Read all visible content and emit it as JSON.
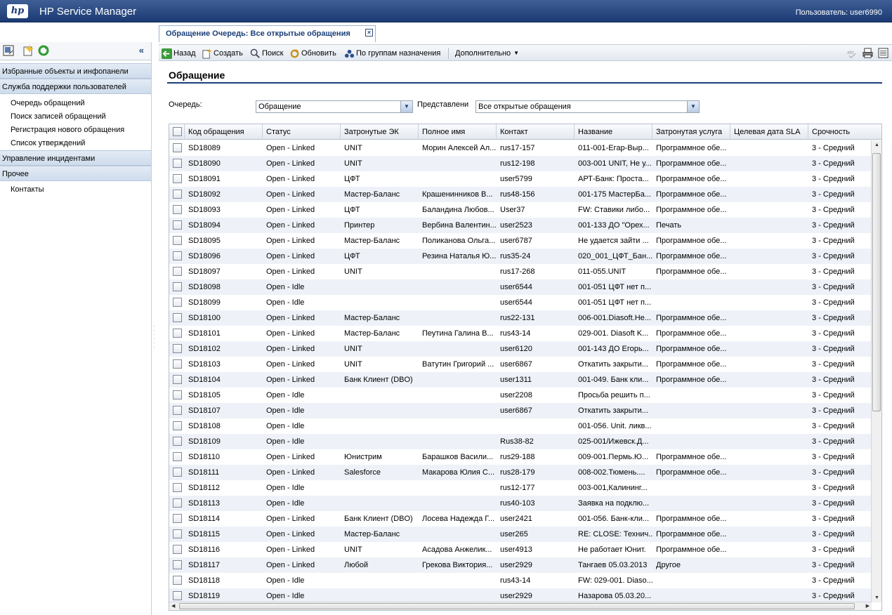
{
  "header": {
    "logo": "hp",
    "app_title": "HP Service Manager",
    "user": "Пользователь: user6990"
  },
  "left_panel": {
    "sections": [
      {
        "label": "Избранные объекты и инфопанели",
        "items": []
      },
      {
        "label": "Служба поддержки пользователей",
        "items": [
          "Очередь обращений",
          "Поиск записей обращений",
          "Регистрация нового обращения",
          "Список утверждений"
        ]
      },
      {
        "label": "Управление инцидентами",
        "items": []
      },
      {
        "label": "Прочее",
        "items": [
          "Контакты"
        ]
      }
    ]
  },
  "tab": {
    "label": "Обращение Очередь: Все открытые обращения"
  },
  "toolbar": {
    "back": "Назад",
    "create": "Создать",
    "search": "Поиск",
    "refresh": "Обновить",
    "by_groups": "По группам назначения",
    "more": "Дополнительно"
  },
  "page": {
    "title": "Обращение",
    "queue_label": "Очередь:",
    "queue_value": "Обращение",
    "view_label": "Представлени",
    "view_value": "Все открытые обращения"
  },
  "grid": {
    "columns": [
      "Код обращения",
      "Статус",
      "Затронутые ЭК",
      "Полное имя",
      "Контакт",
      "Название",
      "Затронутая услуга",
      "Целевая дата SLA",
      "Срочность"
    ],
    "rows": [
      [
        "SD18089",
        "Open - Linked",
        "UNIT",
        "Морин Алексей Ал...",
        "rus17-157",
        "011-001-Егар-Выр...",
        "Программное обе...",
        "",
        "3 - Средний"
      ],
      [
        "SD18090",
        "Open - Linked",
        "UNIT",
        "",
        "rus12-198",
        "003-001 UNIT, Не у...",
        "Программное обе...",
        "",
        "3 - Средний"
      ],
      [
        "SD18091",
        "Open - Linked",
        "ЦФТ",
        "",
        "user5799",
        "АРТ-Банк: Проста...",
        "Программное обе...",
        "",
        "3 - Средний"
      ],
      [
        "SD18092",
        "Open - Linked",
        "Мастер-Баланс",
        "Крашенинников В...",
        "rus48-156",
        "001-175 МастерБа...",
        "Программное обе...",
        "",
        "3 - Средний"
      ],
      [
        "SD18093",
        "Open - Linked",
        "ЦФТ",
        "Баландина Любов...",
        "User37",
        "FW: Ставики либо...",
        "Программное обе...",
        "",
        "3 - Средний"
      ],
      [
        "SD18094",
        "Open - Linked",
        "Принтер",
        "Вербина Валентин...",
        "user2523",
        "001-133 ДО \"Орех...",
        "Печать",
        "",
        "3 - Средний"
      ],
      [
        "SD18095",
        "Open - Linked",
        "Мастер-Баланс",
        "Поликанова Ольга...",
        "user6787",
        "Не удается зайти ...",
        "Программное обе...",
        "",
        "3 - Средний"
      ],
      [
        "SD18096",
        "Open - Linked",
        "ЦФТ",
        "Резина Наталья Ю...",
        "rus35-24",
        "020_001_ЦФТ_Бан...",
        "Программное обе...",
        "",
        "3 - Средний"
      ],
      [
        "SD18097",
        "Open - Linked",
        "UNIT",
        "",
        "rus17-268",
        "011-055.UNIT",
        "Программное обе...",
        "",
        "3 - Средний"
      ],
      [
        "SD18098",
        "Open - Idle",
        "",
        "",
        "user6544",
        "001-051 ЦФТ нет п...",
        "",
        "",
        "3 - Средний"
      ],
      [
        "SD18099",
        "Open - Idle",
        "",
        "",
        "user6544",
        "001-051 ЦФТ нет п...",
        "",
        "",
        "3 - Средний"
      ],
      [
        "SD18100",
        "Open - Linked",
        "Мастер-Баланс",
        "",
        "rus22-131",
        "006-001.Diasoft.Не...",
        "Программное обе...",
        "",
        "3 - Средний"
      ],
      [
        "SD18101",
        "Open - Linked",
        "Мастер-Баланс",
        "Пеутина Галина В...",
        "rus43-14",
        "029-001. Diasoft K...",
        "Программное обе...",
        "",
        "3 - Средний"
      ],
      [
        "SD18102",
        "Open - Linked",
        "UNIT",
        "",
        "user6120",
        "001-143 ДО Егорь...",
        "Программное обе...",
        "",
        "3 - Средний"
      ],
      [
        "SD18103",
        "Open - Linked",
        "UNIT",
        "Ватутин Григорий ...",
        "user6867",
        "Откатить закрыти...",
        "Программное обе...",
        "",
        "3 - Средний"
      ],
      [
        "SD18104",
        "Open - Linked",
        "Банк Клиент (DBO)",
        "",
        "user1311",
        "001-049. Банк кли...",
        "Программное обе...",
        "",
        "3 - Средний"
      ],
      [
        "SD18105",
        "Open - Idle",
        "",
        "",
        "user2208",
        "Просьба решить п...",
        "",
        "",
        "3 - Средний"
      ],
      [
        "SD18107",
        "Open - Idle",
        "",
        "",
        "user6867",
        "Откатить закрыти...",
        "",
        "",
        "3 - Средний"
      ],
      [
        "SD18108",
        "Open - Idle",
        "",
        "",
        "",
        "001-056. Unit. ликв...",
        "",
        "",
        "3 - Средний"
      ],
      [
        "SD18109",
        "Open - Idle",
        "",
        "",
        "Rus38-82",
        "025-001/Ижевск.Д...",
        "",
        "",
        "3 - Средний"
      ],
      [
        "SD18110",
        "Open - Linked",
        "Юнистрим",
        "Барашков Васили...",
        "rus29-188",
        "009-001.Пермь.Ю...",
        "Программное обе...",
        "",
        "3 - Средний"
      ],
      [
        "SD18111",
        "Open - Linked",
        "Salesforce",
        "Макарова Юлия С...",
        "rus28-179",
        "008-002.Тюмень....",
        "Программное обе...",
        "",
        "3 - Средний"
      ],
      [
        "SD18112",
        "Open - Idle",
        "",
        "",
        "rus12-177",
        "003-001,Калининг...",
        "",
        "",
        "3 - Средний"
      ],
      [
        "SD18113",
        "Open - Idle",
        "",
        "",
        "rus40-103",
        "Заявка на подклю...",
        "",
        "",
        "3 - Средний"
      ],
      [
        "SD18114",
        "Open - Linked",
        "Банк Клиент (DBO)",
        "Лосева Надежда Г...",
        "user2421",
        "001-056. Банк-кли...",
        "Программное обе...",
        "",
        "3 - Средний"
      ],
      [
        "SD18115",
        "Open - Linked",
        "Мастер-Баланс",
        "",
        "user265",
        "RE: CLOSE: Технич...",
        "Программное обе...",
        "",
        "3 - Средний"
      ],
      [
        "SD18116",
        "Open - Linked",
        "UNIT",
        "Асадова Анжелик...",
        "user4913",
        "Не работает Юнит.",
        "Программное обе...",
        "",
        "3 - Средний"
      ],
      [
        "SD18117",
        "Open - Linked",
        "Любой",
        "Грекова Виктория...",
        "user2929",
        "Тангаев 05.03.2013",
        "Другое",
        "",
        "3 - Средний"
      ],
      [
        "SD18118",
        "Open - Idle",
        "",
        "",
        "rus43-14",
        "FW: 029-001. Diaso...",
        "",
        "",
        "3 - Средний"
      ],
      [
        "SD18119",
        "Open - Idle",
        "",
        "",
        "user2929",
        "Назарова 05.03.20...",
        "",
        "",
        "3 - Средний"
      ]
    ]
  }
}
